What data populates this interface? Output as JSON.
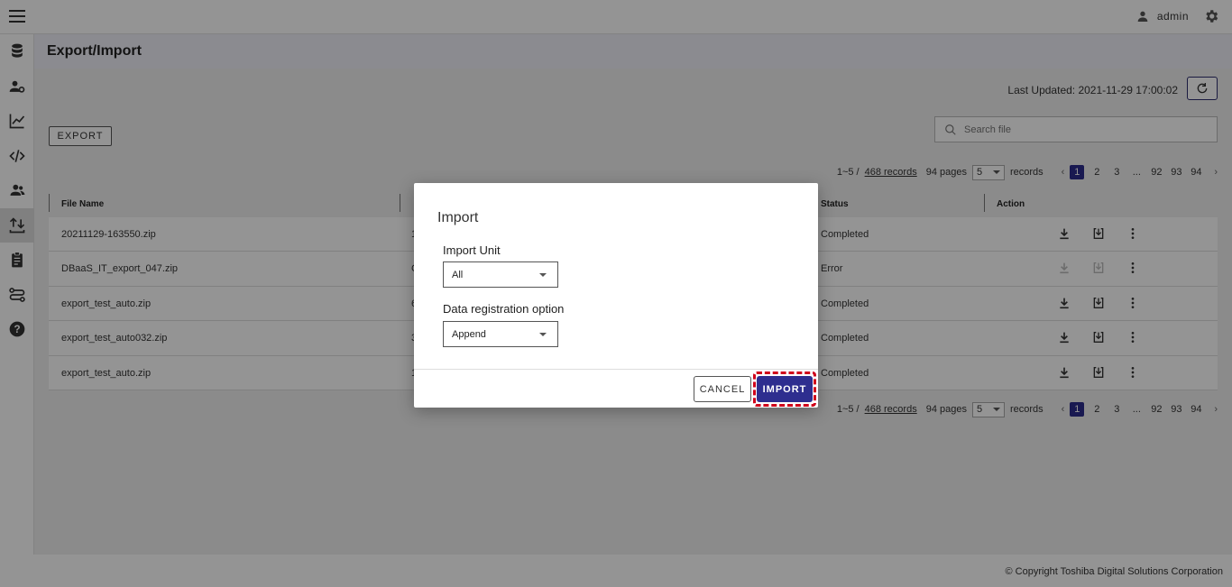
{
  "header": {
    "username": "admin"
  },
  "sidebar": {
    "items": [
      {
        "icon": "database-icon"
      },
      {
        "icon": "user-settings-icon"
      },
      {
        "icon": "chart-line-icon"
      },
      {
        "icon": "code-icon"
      },
      {
        "icon": "users-icon"
      },
      {
        "icon": "export-import-icon"
      },
      {
        "icon": "clipboard-icon"
      },
      {
        "icon": "flow-icon"
      },
      {
        "icon": "help-icon"
      }
    ]
  },
  "page": {
    "title": "Export/Import",
    "last_updated": "Last Updated: 2021-11-29 17:00:02",
    "export_label": "EXPORT",
    "search_placeholder": "Search file"
  },
  "pagination": {
    "range": "1~5 /",
    "records_link": "468 records",
    "pages": "94 pages",
    "page_size": "5",
    "records_label": "records",
    "page_numbers": [
      "1",
      "2",
      "3",
      "...",
      "92",
      "93",
      "94"
    ],
    "current_page": "1"
  },
  "table": {
    "columns": {
      "file_name": "File Name",
      "status": "Status",
      "action": "Action"
    },
    "rows": [
      {
        "file_name": "20211129-163550.zip",
        "partial": "1",
        "status": "Completed",
        "enabled": true
      },
      {
        "file_name": "DBaaS_IT_export_047.zip",
        "partial": "C",
        "status": "Error",
        "enabled": false
      },
      {
        "file_name": "export_test_auto.zip",
        "partial": "6",
        "status": "Completed",
        "enabled": true
      },
      {
        "file_name": "export_test_auto032.zip",
        "partial": "3",
        "status": "Completed",
        "enabled": true
      },
      {
        "file_name": "export_test_auto.zip",
        "partial": "1",
        "status": "Completed",
        "enabled": true
      }
    ]
  },
  "dialog": {
    "title": "Import",
    "import_unit_label": "Import Unit",
    "import_unit_value": "All",
    "registration_label": "Data registration option",
    "registration_value": "Append",
    "cancel_label": "CANCEL",
    "import_label": "IMPORT"
  },
  "footer": {
    "copyright": "© Copyright Toshiba Digital Solutions Corporation"
  },
  "colors": {
    "primary": "#2e2e8f",
    "highlight": "#d0021b"
  }
}
